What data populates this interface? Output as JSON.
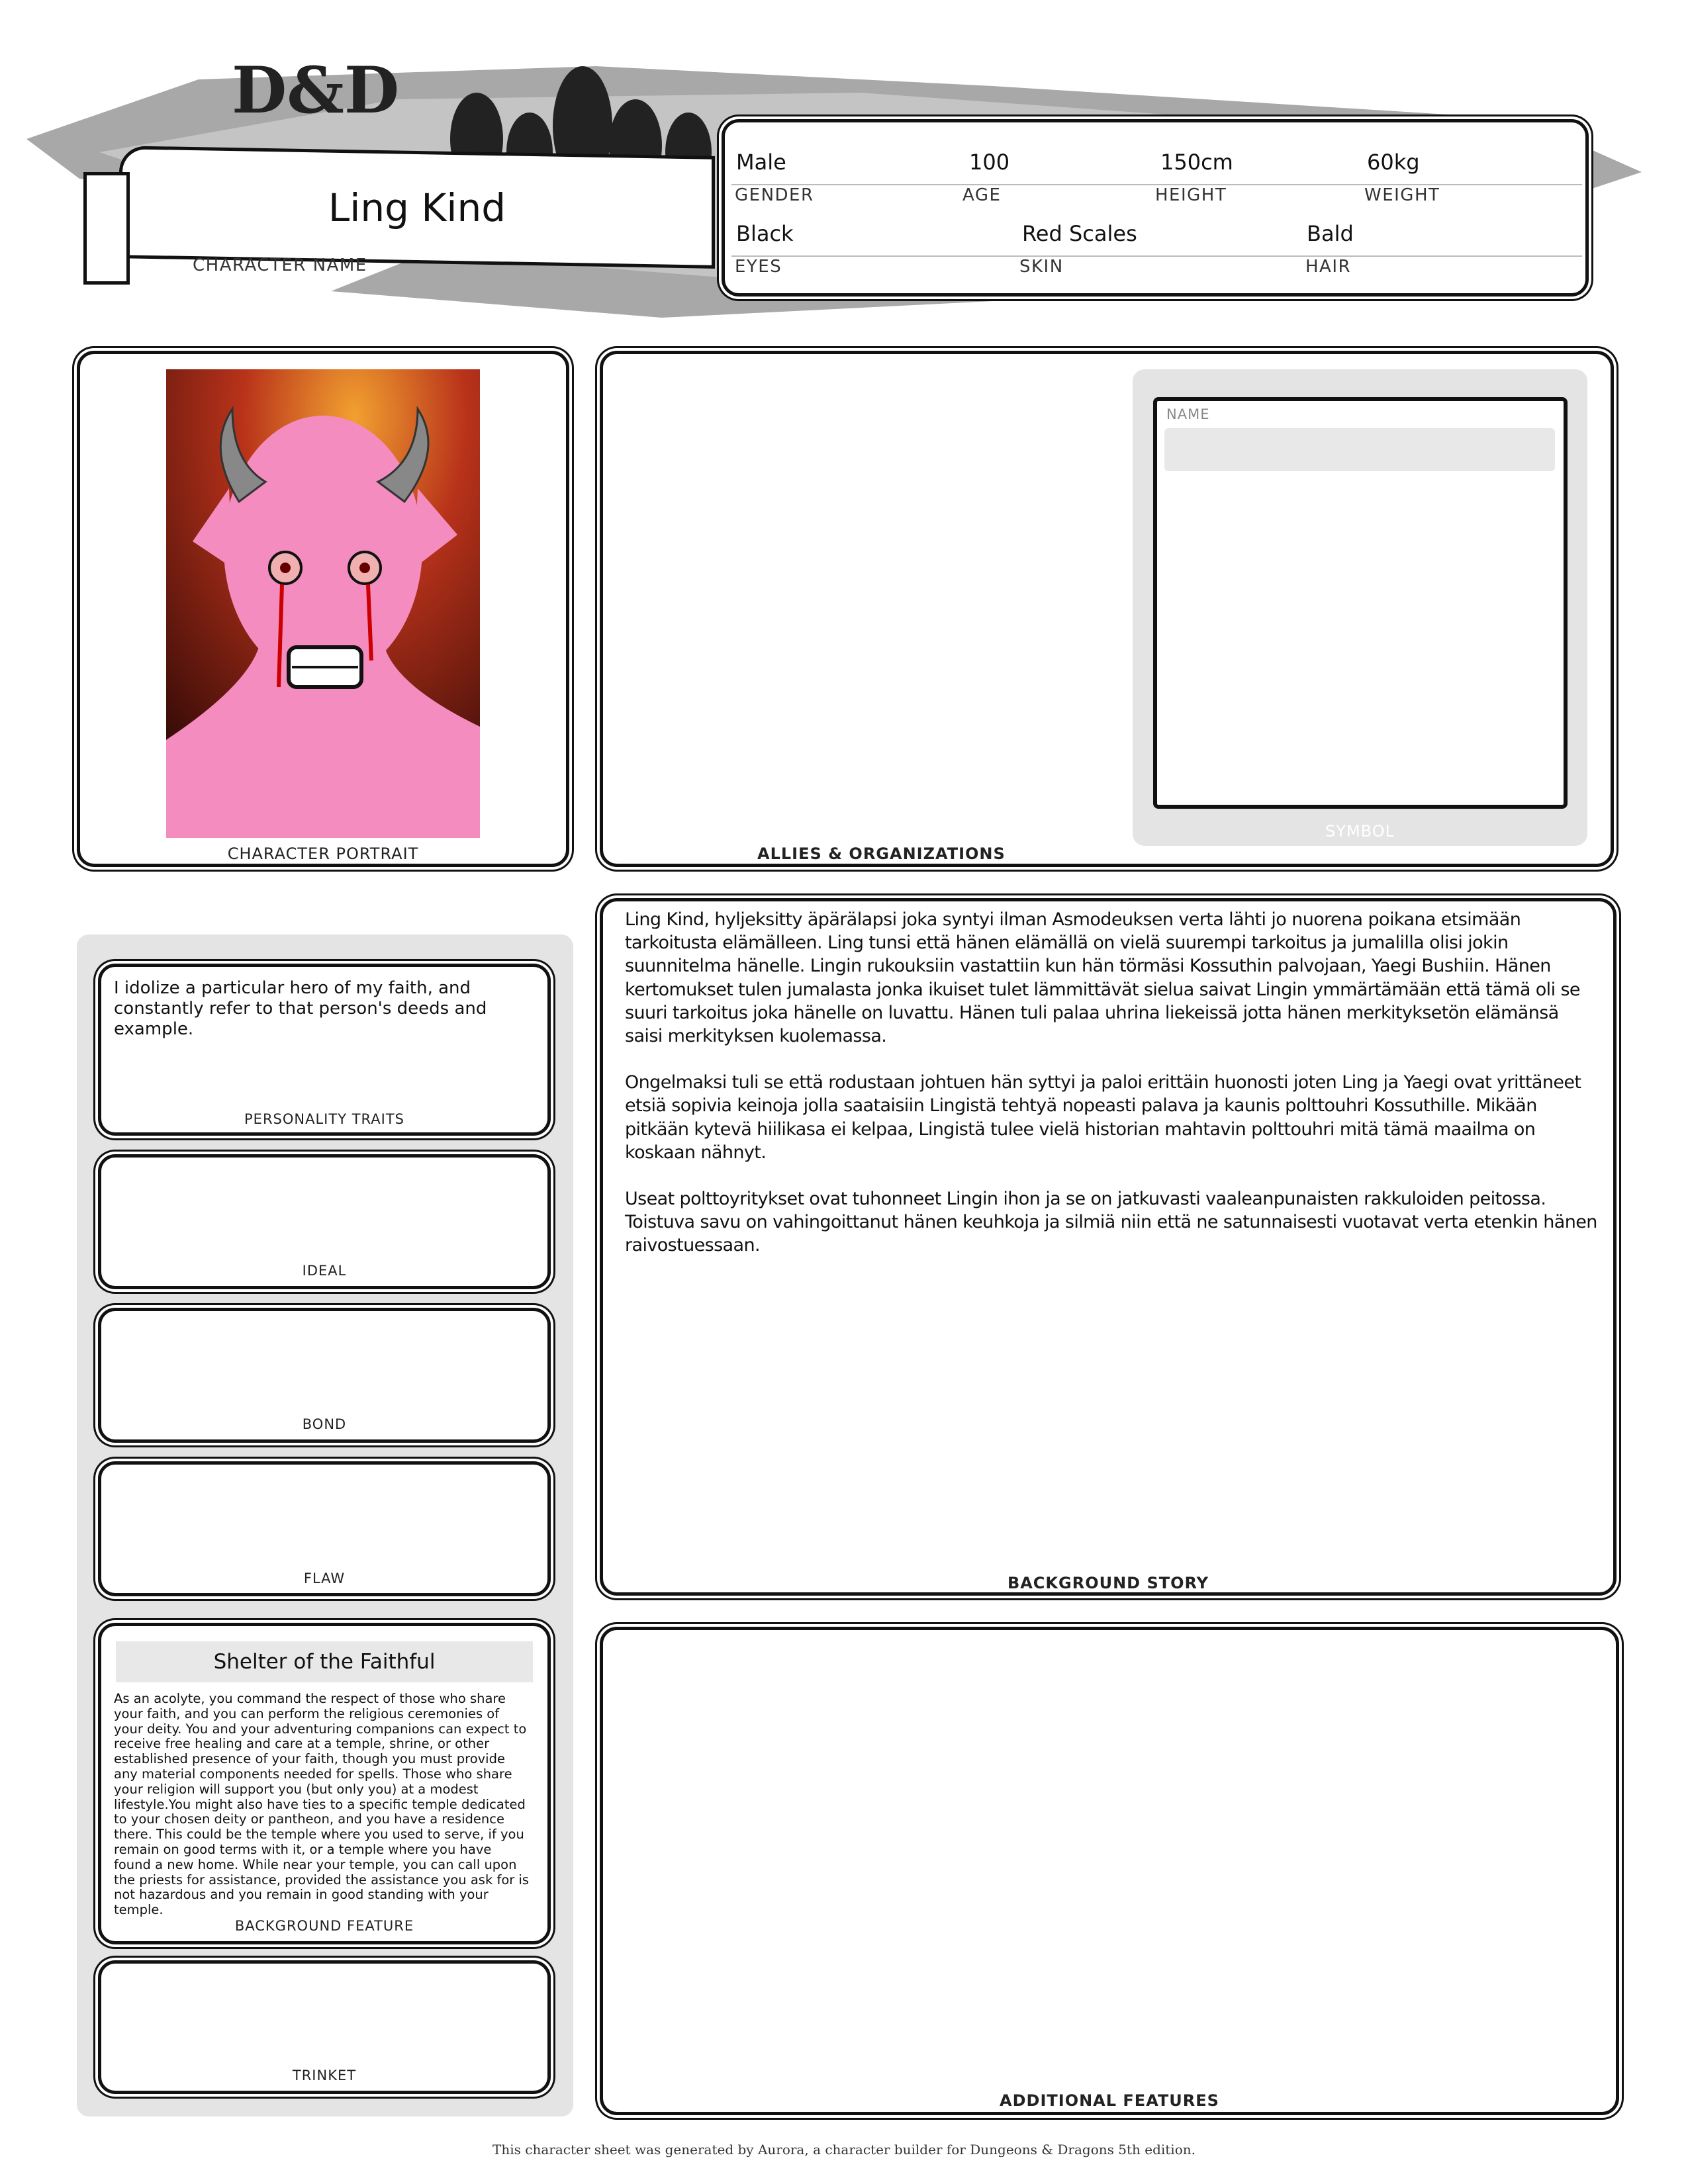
{
  "header": {
    "logo": "D&D",
    "character_name": "Ling Kind",
    "character_name_label": "CHARACTER NAME",
    "details": [
      {
        "value": "Male",
        "label": "GENDER"
      },
      {
        "value": "100",
        "label": "AGE"
      },
      {
        "value": "150cm",
        "label": "HEIGHT"
      },
      {
        "value": "60kg",
        "label": "WEIGHT"
      },
      {
        "value": "Black",
        "label": "EYES"
      },
      {
        "value": "Red Scales",
        "label": "SKIN"
      },
      {
        "value": "Bald",
        "label": "HAIR"
      }
    ]
  },
  "portrait": {
    "label": "CHARACTER PORTRAIT"
  },
  "allies": {
    "label": "ALLIES & ORGANIZATIONS",
    "symbol_name_label": "NAME",
    "symbol_name_value": "",
    "symbol_label": "SYMBOL"
  },
  "traits": {
    "personality": {
      "text": "I idolize a particular hero of my faith, and constantly refer to that person's deeds and example.",
      "label": "PERSONALITY TRAITS"
    },
    "ideal": {
      "text": "",
      "label": "IDEAL"
    },
    "bond": {
      "text": "",
      "label": "BOND"
    },
    "flaw": {
      "text": "",
      "label": "FLAW"
    }
  },
  "feature": {
    "title": "Shelter of the Faithful",
    "text": "As an acolyte, you command the respect of those who share your faith, and you can perform the religious ceremonies of your deity. You and your adventuring companions can expect to receive free healing and care at a temple, shrine, or other established presence of your faith, though you must provide any material components needed for spells. Those who share your religion will support you (but only you) at a modest lifestyle.You might also have ties to a specific temple dedicated to your chosen deity or pantheon, and you have a residence there. This could be the temple where you used to serve, if you remain on good terms with it, or a temple where you have found a new home. While near your temple, you can call upon the priests for assistance, provided the assistance you ask for is not hazardous and you remain in good standing with your temple.",
    "label": "BACKGROUND FEATURE"
  },
  "trinket": {
    "label": "TRINKET"
  },
  "background_story": {
    "paragraphs": [
      "Ling Kind, hyljeksitty äpärälapsi joka syntyi ilman Asmodeuksen verta lähti jo nuorena poikana etsimään tarkoitusta elämälleen. Ling tunsi että hänen elämällä on vielä suurempi tarkoitus ja jumalilla olisi jokin suunnitelma hänelle. Lingin rukouksiin vastattiin kun hän törmäsi Kossuthin palvojaan, Yaegi Bushiin. Hänen kertomukset tulen jumalasta jonka ikuiset tulet lämmittävät sielua saivat Lingin ymmärtämään että tämä oli se suuri tarkoitus joka hänelle on luvattu. Hänen tuli palaa uhrina liekeissä jotta hänen merkityksetön elämänsä saisi merkityksen kuolemassa.",
      "Ongelmaksi tuli se että rodustaan johtuen hän syttyi ja paloi erittäin huonosti joten Ling ja Yaegi ovat yrittäneet etsiä sopivia keinoja jolla saataisiin Lingistä tehtyä nopeasti palava ja kaunis polttouhri Kossuthille. Mikään pitkään kytevä hiilikasa ei kelpaa, Lingistä tulee vielä historian mahtavin polttouhri mitä tämä maailma on koskaan nähnyt.",
      "Useat polttoyritykset ovat tuhonneet Lingin ihon ja se on jatkuvasti vaaleanpunaisten rakkuloiden peitossa. Toistuva savu on vahingoittanut hänen keuhkoja ja silmiä niin että ne satunnaisesti vuotavat verta etenkin hänen raivostuessaan."
    ],
    "label": "BACKGROUND STORY"
  },
  "additional_features": {
    "label": "ADDITIONAL FEATURES"
  },
  "footer": "This character sheet was generated by Aurora, a character builder for Dungeons & Dragons 5th edition."
}
